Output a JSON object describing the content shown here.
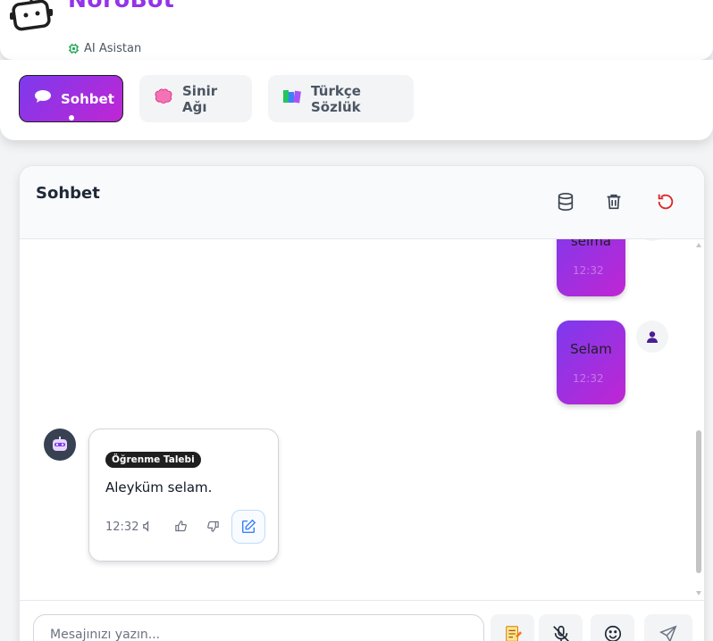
{
  "app": {
    "brand": "NöröBot",
    "subtitle": "AI Asistan"
  },
  "tabs": [
    {
      "label": "Sohbet",
      "icon": "speech-bubble-icon",
      "active": true
    },
    {
      "label": "Sinir Ağı",
      "icon": "brain-icon",
      "active": false
    },
    {
      "label": "Türkçe Sözlük",
      "icon": "books-icon",
      "active": false
    }
  ],
  "chat": {
    "title": "Sohbet",
    "header_icons": [
      "database-icon",
      "trash-icon",
      "refresh-icon"
    ],
    "messages": [
      {
        "role": "user",
        "text": "selma",
        "time": "12:32"
      },
      {
        "role": "user",
        "text": "Selam",
        "time": "12:32"
      },
      {
        "role": "bot",
        "badge": "Öğrenme Talebi",
        "text": "Aleyküm selam.",
        "time": "12:32"
      }
    ],
    "input": {
      "placeholder": "Mesajınızı yazın..."
    }
  },
  "colors": {
    "accent_start": "#7c3aed",
    "accent_end": "#c026d3",
    "brand": "#9333ea",
    "danger": "#dc2626"
  }
}
